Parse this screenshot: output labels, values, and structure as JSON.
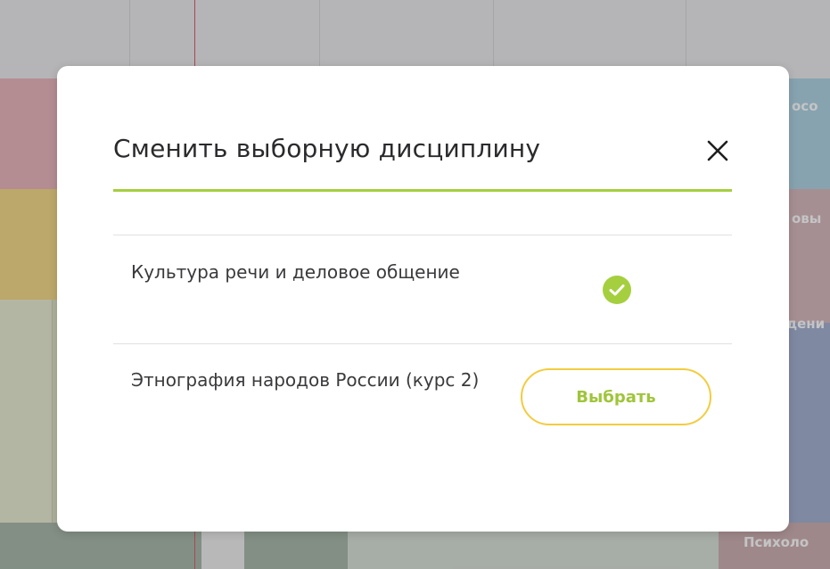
{
  "background": {
    "right_labels": [
      "осо",
      "овы",
      "дени"
    ],
    "bottom_label": "Психоло"
  },
  "modal": {
    "title": "Сменить выборную дисциплину",
    "close_icon": "close-icon",
    "accent_color": "#a5cf3f",
    "items": [
      {
        "label": "Культура речи и деловое общение",
        "selected": true,
        "status_icon": "check-circle-icon"
      },
      {
        "label": "Этнография народов России (курс 2)",
        "selected": false,
        "action_label": "Выбрать"
      }
    ]
  },
  "colors": {
    "button_border": "#f3cc3f",
    "button_text": "#9fc53a",
    "check_fill": "#a5cf3f"
  }
}
